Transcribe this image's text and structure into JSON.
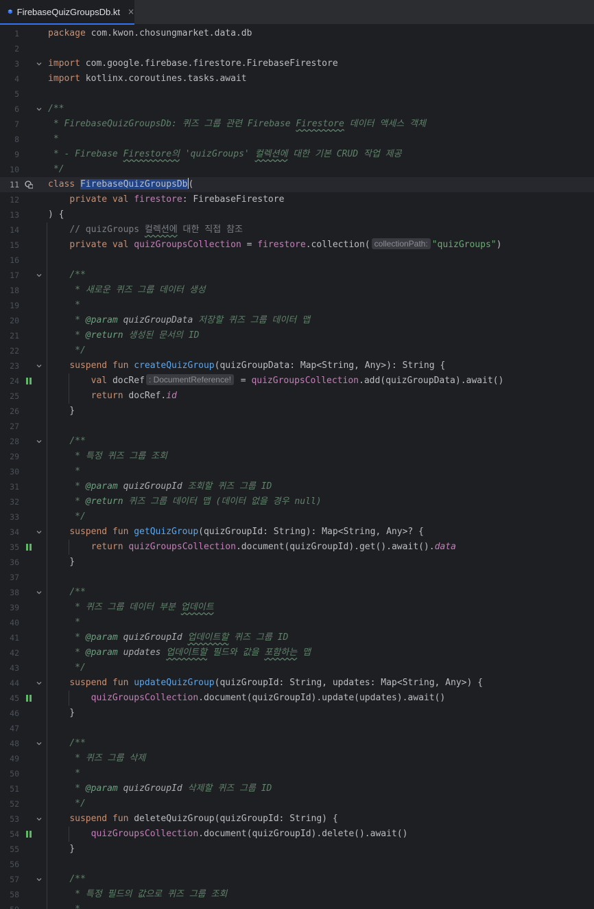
{
  "tab": {
    "filename": "FirebaseQuizGroupsDb.kt",
    "close": "×",
    "icon": "kotlin-file-icon"
  },
  "gutter_icons": {
    "class_line": "implemented-lock-icon",
    "suspend_call": "suspend-call-icon",
    "fold": "chevron-down-icon"
  },
  "current_line": 11,
  "lines": [
    {
      "n": "1",
      "fold": false,
      "g": "",
      "segs": [
        [
          "kw",
          "package "
        ],
        [
          "",
          "com.kwon.chosungmarket.data.db"
        ]
      ]
    },
    {
      "n": "2",
      "fold": false,
      "g": "",
      "segs": []
    },
    {
      "n": "3",
      "fold": true,
      "g": "",
      "segs": [
        [
          "kw",
          "import "
        ],
        [
          "",
          "com.google.firebase.firestore.FirebaseFirestore"
        ]
      ]
    },
    {
      "n": "4",
      "fold": false,
      "g": "",
      "segs": [
        [
          "kw",
          "import "
        ],
        [
          "",
          "kotlinx.coroutines.tasks.await"
        ]
      ]
    },
    {
      "n": "5",
      "fold": false,
      "g": "",
      "segs": []
    },
    {
      "n": "6",
      "fold": true,
      "g": "",
      "segs": [
        [
          "doc",
          "/**"
        ]
      ]
    },
    {
      "n": "7",
      "fold": false,
      "g": "",
      "segs": [
        [
          "doc",
          " * FirebaseQuizGroupsDb: 퀴즈 그룹 관련 Firebase "
        ],
        [
          "doc wavy",
          "Firestore"
        ],
        [
          "doc",
          " 데이터 액세스 객체"
        ]
      ]
    },
    {
      "n": "8",
      "fold": false,
      "g": "",
      "segs": [
        [
          "doc",
          " *"
        ]
      ]
    },
    {
      "n": "9",
      "fold": false,
      "g": "",
      "segs": [
        [
          "doc",
          " * - Firebase "
        ],
        [
          "doc wavy",
          "Firestore의"
        ],
        [
          "doc",
          " 'quizGroups' "
        ],
        [
          "doc wavy",
          "컬렉션에"
        ],
        [
          "doc",
          " 대한 기본 CRUD 작업 제공"
        ]
      ]
    },
    {
      "n": "10",
      "fold": false,
      "g": "",
      "segs": [
        [
          "doc",
          " */"
        ]
      ]
    },
    {
      "n": "11",
      "fold": false,
      "g": "lock",
      "segs": [
        [
          "kw",
          "class "
        ],
        [
          "sel",
          "FirebaseQuizGroupsDb"
        ],
        [
          "caret",
          ""
        ],
        [
          "",
          "("
        ]
      ]
    },
    {
      "n": "12",
      "fold": false,
      "g": "",
      "segs": [
        [
          "",
          "    "
        ],
        [
          "kw",
          "private val "
        ],
        [
          "prop",
          "firestore"
        ],
        [
          "",
          ": FirebaseFirestore"
        ]
      ]
    },
    {
      "n": "13",
      "fold": false,
      "g": "",
      "segs": [
        [
          "",
          ") {"
        ]
      ]
    },
    {
      "n": "14",
      "fold": false,
      "g": "",
      "segs": [
        [
          "",
          "    "
        ],
        [
          "cmt",
          "// quizGroups "
        ],
        [
          "cmt wavy",
          "컬렉션에"
        ],
        [
          "cmt",
          " 대한 직접 참조"
        ]
      ]
    },
    {
      "n": "15",
      "fold": false,
      "g": "",
      "segs": [
        [
          "",
          "    "
        ],
        [
          "kw",
          "private val "
        ],
        [
          "prop",
          "quizGroupsCollection"
        ],
        [
          "",
          " = "
        ],
        [
          "prop",
          "firestore"
        ],
        [
          "",
          ".collection("
        ],
        [
          "hint",
          "collectionPath:"
        ],
        [
          "str",
          "\"quizGroups\""
        ],
        [
          "",
          ")"
        ]
      ]
    },
    {
      "n": "16",
      "fold": false,
      "g": "",
      "segs": []
    },
    {
      "n": "17",
      "fold": true,
      "g": "",
      "segs": [
        [
          "",
          "    "
        ],
        [
          "doc",
          "/**"
        ]
      ]
    },
    {
      "n": "18",
      "fold": false,
      "g": "",
      "segs": [
        [
          "",
          "    "
        ],
        [
          "doc",
          " * 새로운 퀴즈 그룹 데이터 생성"
        ]
      ]
    },
    {
      "n": "19",
      "fold": false,
      "g": "",
      "segs": [
        [
          "",
          "    "
        ],
        [
          "doc",
          " *"
        ]
      ]
    },
    {
      "n": "20",
      "fold": false,
      "g": "",
      "segs": [
        [
          "",
          "    "
        ],
        [
          "doc",
          " * "
        ],
        [
          "doctag",
          "@param"
        ],
        [
          "docname",
          " quizGroupData"
        ],
        [
          "doc",
          " 저장할 퀴즈 그룹 데이터 맵"
        ]
      ]
    },
    {
      "n": "21",
      "fold": false,
      "g": "",
      "segs": [
        [
          "",
          "    "
        ],
        [
          "doc",
          " * "
        ],
        [
          "doctag",
          "@return"
        ],
        [
          "doc",
          " 생성된 문서의 ID"
        ]
      ]
    },
    {
      "n": "22",
      "fold": false,
      "g": "",
      "segs": [
        [
          "",
          "    "
        ],
        [
          "doc",
          " */"
        ]
      ]
    },
    {
      "n": "23",
      "fold": true,
      "g": "",
      "segs": [
        [
          "",
          "    "
        ],
        [
          "kw",
          "suspend fun "
        ],
        [
          "fn",
          "createQuizGroup"
        ],
        [
          "",
          "(quizGroupData: Map<String, Any>): String {"
        ]
      ]
    },
    {
      "n": "24",
      "fold": false,
      "g": "suspend",
      "segs": [
        [
          "",
          "        "
        ],
        [
          "kw",
          "val "
        ],
        [
          "",
          "docRef"
        ],
        [
          "hint",
          ": DocumentReference!"
        ],
        [
          "",
          " = "
        ],
        [
          "prop",
          "quizGroupsCollection"
        ],
        [
          "",
          ".add(quizGroupData).await()"
        ]
      ]
    },
    {
      "n": "25",
      "fold": false,
      "g": "",
      "segs": [
        [
          "",
          "        "
        ],
        [
          "kw",
          "return "
        ],
        [
          "",
          "docRef."
        ],
        [
          "propi",
          "id"
        ]
      ]
    },
    {
      "n": "26",
      "fold": false,
      "g": "",
      "segs": [
        [
          "",
          "    }"
        ]
      ]
    },
    {
      "n": "27",
      "fold": false,
      "g": "",
      "segs": []
    },
    {
      "n": "28",
      "fold": true,
      "g": "",
      "segs": [
        [
          "",
          "    "
        ],
        [
          "doc",
          "/**"
        ]
      ]
    },
    {
      "n": "29",
      "fold": false,
      "g": "",
      "segs": [
        [
          "",
          "    "
        ],
        [
          "doc",
          " * 특정 퀴즈 그룹 조회"
        ]
      ]
    },
    {
      "n": "30",
      "fold": false,
      "g": "",
      "segs": [
        [
          "",
          "    "
        ],
        [
          "doc",
          " *"
        ]
      ]
    },
    {
      "n": "31",
      "fold": false,
      "g": "",
      "segs": [
        [
          "",
          "    "
        ],
        [
          "doc",
          " * "
        ],
        [
          "doctag",
          "@param"
        ],
        [
          "docname",
          " quizGroupId"
        ],
        [
          "doc",
          " 조회할 퀴즈 그룹 ID"
        ]
      ]
    },
    {
      "n": "32",
      "fold": false,
      "g": "",
      "segs": [
        [
          "",
          "    "
        ],
        [
          "doc",
          " * "
        ],
        [
          "doctag",
          "@return"
        ],
        [
          "doc",
          " 퀴즈 그룹 데이터 맵 (데이터 없을 경우 null)"
        ]
      ]
    },
    {
      "n": "33",
      "fold": false,
      "g": "",
      "segs": [
        [
          "",
          "    "
        ],
        [
          "doc",
          " */"
        ]
      ]
    },
    {
      "n": "34",
      "fold": true,
      "g": "",
      "segs": [
        [
          "",
          "    "
        ],
        [
          "kw",
          "suspend fun "
        ],
        [
          "fn",
          "getQuizGroup"
        ],
        [
          "",
          "(quizGroupId: String): Map<String, Any>? {"
        ]
      ]
    },
    {
      "n": "35",
      "fold": false,
      "g": "suspend",
      "segs": [
        [
          "",
          "        "
        ],
        [
          "kw",
          "return "
        ],
        [
          "prop",
          "quizGroupsCollection"
        ],
        [
          "",
          ".document(quizGroupId).get().await()."
        ],
        [
          "propi",
          "data"
        ]
      ]
    },
    {
      "n": "36",
      "fold": false,
      "g": "",
      "segs": [
        [
          "",
          "    }"
        ]
      ]
    },
    {
      "n": "37",
      "fold": false,
      "g": "",
      "segs": []
    },
    {
      "n": "38",
      "fold": true,
      "g": "",
      "segs": [
        [
          "",
          "    "
        ],
        [
          "doc",
          "/**"
        ]
      ]
    },
    {
      "n": "39",
      "fold": false,
      "g": "",
      "segs": [
        [
          "",
          "    "
        ],
        [
          "doc",
          " * 퀴즈 그룹 데이터 부분 "
        ],
        [
          "doc wavy",
          "업데이트"
        ]
      ]
    },
    {
      "n": "40",
      "fold": false,
      "g": "",
      "segs": [
        [
          "",
          "    "
        ],
        [
          "doc",
          " *"
        ]
      ]
    },
    {
      "n": "41",
      "fold": false,
      "g": "",
      "segs": [
        [
          "",
          "    "
        ],
        [
          "doc",
          " * "
        ],
        [
          "doctag",
          "@param"
        ],
        [
          "docname",
          " quizGroupId"
        ],
        [
          "doc",
          " "
        ],
        [
          "doc wavy",
          "업데이트할"
        ],
        [
          "doc",
          " 퀴즈 그룹 ID"
        ]
      ]
    },
    {
      "n": "42",
      "fold": false,
      "g": "",
      "segs": [
        [
          "",
          "    "
        ],
        [
          "doc",
          " * "
        ],
        [
          "doctag",
          "@param"
        ],
        [
          "docname",
          " updates"
        ],
        [
          "doc",
          " "
        ],
        [
          "doc wavy",
          "업데이트할"
        ],
        [
          "doc",
          " 필드와 값을 "
        ],
        [
          "doc wavy",
          "포함하는"
        ],
        [
          "doc",
          " 맵"
        ]
      ]
    },
    {
      "n": "43",
      "fold": false,
      "g": "",
      "segs": [
        [
          "",
          "    "
        ],
        [
          "doc",
          " */"
        ]
      ]
    },
    {
      "n": "44",
      "fold": true,
      "g": "",
      "segs": [
        [
          "",
          "    "
        ],
        [
          "kw",
          "suspend fun "
        ],
        [
          "fn",
          "updateQuizGroup"
        ],
        [
          "",
          "(quizGroupId: String, updates: Map<String, Any>) {"
        ]
      ]
    },
    {
      "n": "45",
      "fold": false,
      "g": "suspend",
      "segs": [
        [
          "",
          "        "
        ],
        [
          "prop",
          "quizGroupsCollection"
        ],
        [
          "",
          ".document(quizGroupId).update(updates).await()"
        ]
      ]
    },
    {
      "n": "46",
      "fold": false,
      "g": "",
      "segs": [
        [
          "",
          "    }"
        ]
      ]
    },
    {
      "n": "47",
      "fold": false,
      "g": "",
      "segs": []
    },
    {
      "n": "48",
      "fold": true,
      "g": "",
      "segs": [
        [
          "",
          "    "
        ],
        [
          "doc",
          "/**"
        ]
      ]
    },
    {
      "n": "49",
      "fold": false,
      "g": "",
      "segs": [
        [
          "",
          "    "
        ],
        [
          "doc",
          " * 퀴즈 그룹 삭제"
        ]
      ]
    },
    {
      "n": "50",
      "fold": false,
      "g": "",
      "segs": [
        [
          "",
          "    "
        ],
        [
          "doc",
          " *"
        ]
      ]
    },
    {
      "n": "51",
      "fold": false,
      "g": "",
      "segs": [
        [
          "",
          "    "
        ],
        [
          "doc",
          " * "
        ],
        [
          "doctag",
          "@param"
        ],
        [
          "docname",
          " quizGroupId"
        ],
        [
          "doc",
          " 삭제할 퀴즈 그룹 ID"
        ]
      ]
    },
    {
      "n": "52",
      "fold": false,
      "g": "",
      "segs": [
        [
          "",
          "    "
        ],
        [
          "doc",
          " */"
        ]
      ]
    },
    {
      "n": "53",
      "fold": true,
      "g": "",
      "segs": [
        [
          "",
          "    "
        ],
        [
          "kw",
          "suspend fun "
        ],
        [
          "fnplain",
          "deleteQuizGroup"
        ],
        [
          "",
          "(quizGroupId: String) {"
        ]
      ]
    },
    {
      "n": "54",
      "fold": false,
      "g": "suspend",
      "segs": [
        [
          "",
          "        "
        ],
        [
          "prop",
          "quizGroupsCollection"
        ],
        [
          "",
          ".document(quizGroupId).delete().await()"
        ]
      ]
    },
    {
      "n": "55",
      "fold": false,
      "g": "",
      "segs": [
        [
          "",
          "    }"
        ]
      ]
    },
    {
      "n": "56",
      "fold": false,
      "g": "",
      "segs": []
    },
    {
      "n": "57",
      "fold": true,
      "g": "",
      "segs": [
        [
          "",
          "    "
        ],
        [
          "doc",
          "/**"
        ]
      ]
    },
    {
      "n": "58",
      "fold": false,
      "g": "",
      "segs": [
        [
          "",
          "    "
        ],
        [
          "doc",
          " * 특정 필드의 값으로 퀴즈 그룹 조회"
        ]
      ]
    },
    {
      "n": "59",
      "fold": false,
      "g": "",
      "segs": [
        [
          "",
          "    "
        ],
        [
          "doc",
          " *"
        ]
      ]
    }
  ]
}
